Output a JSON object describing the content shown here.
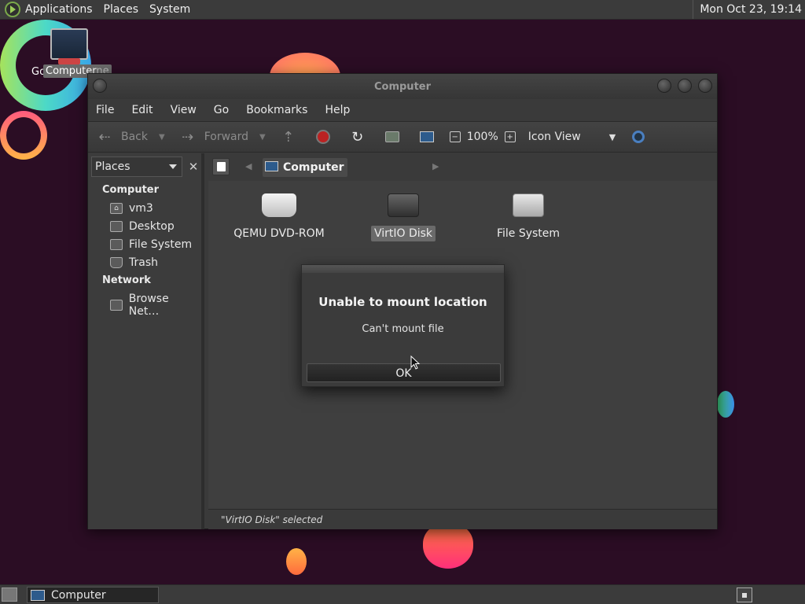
{
  "top_panel": {
    "menus": [
      "Applications",
      "Places",
      "System"
    ],
    "clock": "Mon Oct 23, 19:14"
  },
  "desktop": {
    "icon_label_behind": "Go",
    "icon_label": "Computer",
    "icon_label_tail": "ne"
  },
  "window": {
    "title": "Computer",
    "menubar": [
      "File",
      "Edit",
      "View",
      "Go",
      "Bookmarks",
      "Help"
    ],
    "toolbar": {
      "back": "Back",
      "forward": "Forward",
      "zoom": "100%",
      "view_mode": "Icon View"
    },
    "sidebar": {
      "selector": "Places",
      "sections": [
        {
          "heading": "Computer",
          "items": [
            "vm3",
            "Desktop",
            "File System",
            "Trash"
          ]
        },
        {
          "heading": "Network",
          "items": [
            "Browse Net…"
          ]
        }
      ]
    },
    "pathbar": {
      "crumb": "Computer"
    },
    "items": [
      {
        "name": "QEMU DVD-ROM",
        "selected": false
      },
      {
        "name": "VirtIO Disk",
        "selected": true
      },
      {
        "name": "File System",
        "selected": false
      }
    ],
    "status": "\"VirtIO Disk\" selected"
  },
  "dialog": {
    "title": "Unable to mount location",
    "message": "Can't mount file",
    "ok": "OK"
  },
  "bottom_panel": {
    "task": "Computer"
  }
}
